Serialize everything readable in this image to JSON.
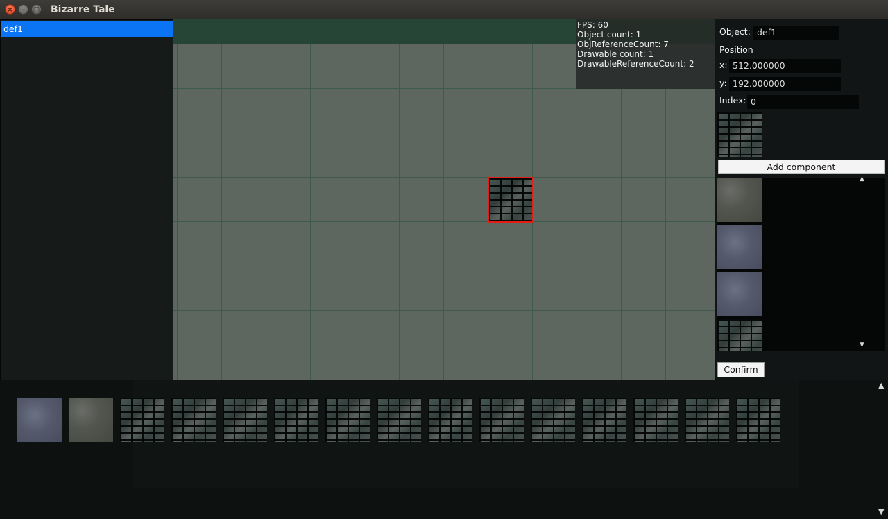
{
  "window": {
    "title": "Bizarre Tale"
  },
  "object_list": {
    "items": [
      "def1"
    ]
  },
  "stats": {
    "fps": "FPS: 60",
    "object_count": "Object count: 1",
    "obj_reference_count": "ObjReferenceCount: 7",
    "drawable_count": "Drawable count: 1",
    "drawable_reference_count": "DrawableReferenceCount: 2"
  },
  "properties": {
    "object_label": "Object:",
    "object_value": "def1",
    "position_label": "Position",
    "x_label": "x:",
    "x_value": "512.000000",
    "y_label": "y:",
    "y_value": "192.000000",
    "index_label": "Index:",
    "index_value": "0",
    "add_component": "Add component",
    "confirm": "Confirm",
    "component_textures": [
      "stone",
      "slate",
      "slate",
      "brick"
    ]
  },
  "assets": {
    "textures": [
      "slate",
      "stone",
      "brick",
      "brick",
      "brick",
      "brick",
      "brick",
      "brick",
      "brick",
      "brick",
      "brick",
      "brick",
      "brick",
      "brick",
      "brick"
    ]
  },
  "colors": {
    "selection": "#0a74f5",
    "highlight_border": "#e0201a",
    "grid_background": "#5e6660",
    "grid_line": "#3e5a4c"
  },
  "icons": {
    "close": "close-icon",
    "minimize": "minimize-icon",
    "maximize": "maximize-icon",
    "scroll_up": "scroll-up-arrow-icon",
    "scroll_down": "scroll-down-arrow-icon"
  }
}
